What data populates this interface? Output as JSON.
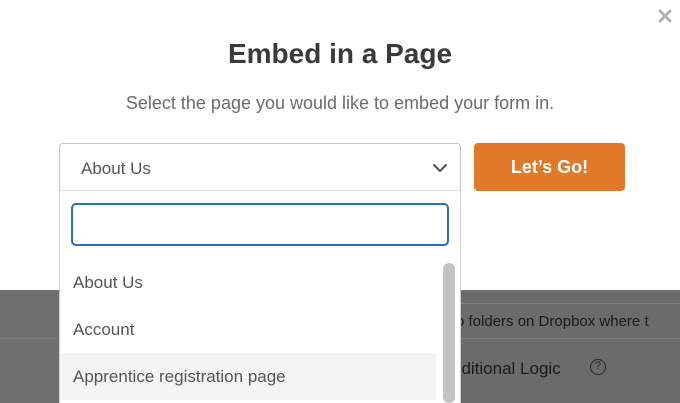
{
  "modal": {
    "title": "Embed in a Page",
    "subtitle": "Select the page you would like to embed your form in.",
    "close_icon": "close-icon"
  },
  "select": {
    "selected_value": "About Us",
    "chevron_icon": "chevron-down-icon"
  },
  "go_button": {
    "label": "Let’s Go!",
    "color": "#e07a2a"
  },
  "dropdown": {
    "search_value": "",
    "search_placeholder": "",
    "options": [
      {
        "label": "About Us"
      },
      {
        "label": "Account"
      },
      {
        "label": "Apprentice registration page"
      }
    ]
  },
  "background": {
    "text_dropbox": "o folders on Dropbox where t",
    "text_logic": "nditional Logic",
    "help_icon": "help-icon",
    "help_glyph": "?"
  },
  "colors": {
    "accent": "#e07a2a",
    "focus": "#2d6fb7",
    "backdrop": "#707070"
  }
}
